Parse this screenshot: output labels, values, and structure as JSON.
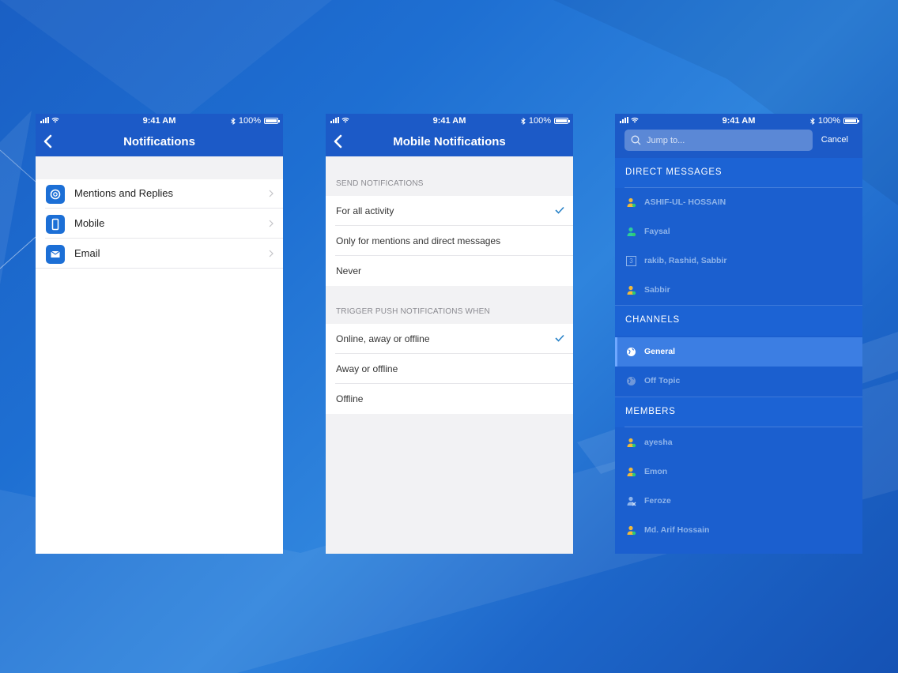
{
  "colors": {
    "brand": "#1c5ac7",
    "check": "#2a83c8",
    "panel_dark": "#1b5fcf"
  },
  "screen1": {
    "status": {
      "time": "9:41 AM",
      "battery": "100%"
    },
    "title": "Notifications",
    "items": [
      {
        "label": "Mentions and Replies",
        "icon": "at-sign-icon"
      },
      {
        "label": "Mobile",
        "icon": "mobile-phone-icon"
      },
      {
        "label": "Email",
        "icon": "envelope-icon"
      }
    ]
  },
  "screen2": {
    "status": {
      "time": "9:41 AM",
      "battery": "100%"
    },
    "title": "Mobile Notifications",
    "send_header": "SEND NOTIFICATIONS",
    "send_options": [
      {
        "label": "For all activity",
        "selected": true
      },
      {
        "label": "Only for mentions and direct messages",
        "selected": false
      },
      {
        "label": "Never",
        "selected": false
      }
    ],
    "trigger_header": "TRIGGER PUSH NOTIFICATIONS WHEN",
    "trigger_options": [
      {
        "label": "Online, away or offline",
        "selected": true
      },
      {
        "label": "Away or offline",
        "selected": false
      },
      {
        "label": "Offline",
        "selected": false
      }
    ]
  },
  "screen3": {
    "status": {
      "time": "9:41 AM",
      "battery": "100%"
    },
    "search_placeholder": "Jump to...",
    "cancel": "Cancel",
    "direct_header": "DIRECT MESSAGES",
    "direct": [
      {
        "name": "ASHIF-UL- HOSSAIN",
        "icon": "user-online-icon"
      },
      {
        "name": "Faysal",
        "icon": "user-active-icon"
      },
      {
        "name": "rakib, Rashid, Sabbir",
        "icon": "group-count-icon",
        "count": "3"
      },
      {
        "name": "Sabbir",
        "icon": "user-online-icon"
      }
    ],
    "channels_header": "CHANNELS",
    "channels": [
      {
        "name": "General",
        "icon": "globe-icon",
        "active": true
      },
      {
        "name": "Off Topic",
        "icon": "globe-icon",
        "active": false
      }
    ],
    "members_header": "MEMBERS",
    "members": [
      {
        "name": "ayesha",
        "icon": "user-online-icon"
      },
      {
        "name": "Emon",
        "icon": "user-online-icon"
      },
      {
        "name": "Feroze",
        "icon": "user-offline-icon"
      },
      {
        "name": "Md. Arif Hossain",
        "icon": "user-online-icon"
      }
    ]
  }
}
